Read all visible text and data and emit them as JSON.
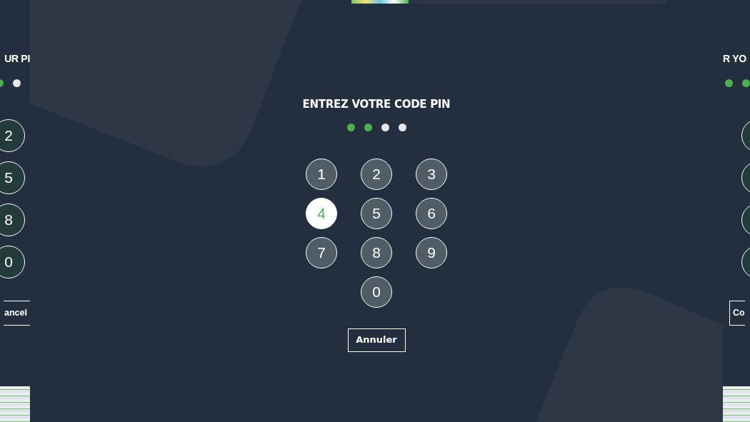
{
  "left_panel": {
    "title": "UR PI",
    "dots": [
      {
        "filled": true
      },
      {
        "filled": false
      }
    ],
    "keys": [
      {
        "label": "2",
        "selected": false
      },
      {
        "label": "5",
        "selected": false
      },
      {
        "label": "8",
        "selected": false
      },
      {
        "label": "0",
        "selected": false
      }
    ],
    "cancel_button": "ancel"
  },
  "main_panel": {
    "title": "ENTREZ VOTRE CODE PIN",
    "dots": [
      {
        "filled": true
      },
      {
        "filled": true
      },
      {
        "filled": false
      },
      {
        "filled": false
      }
    ],
    "keys": [
      {
        "label": "1",
        "selected": false
      },
      {
        "label": "2",
        "selected": false
      },
      {
        "label": "3",
        "selected": false
      },
      {
        "label": "4",
        "selected": true
      },
      {
        "label": "5",
        "selected": false
      },
      {
        "label": "6",
        "selected": false
      },
      {
        "label": "7",
        "selected": false
      },
      {
        "label": "8",
        "selected": false
      },
      {
        "label": "9",
        "selected": false
      },
      {
        "label": "0",
        "selected": false
      }
    ],
    "cancel_button": "Annuler"
  },
  "right_panel": {
    "title": "R YO",
    "dots": [
      {
        "filled": true
      },
      {
        "filled": true
      }
    ],
    "keys": [
      {
        "selected": false
      },
      {
        "selected": false
      },
      {
        "selected": false
      },
      {
        "selected": false
      }
    ],
    "cancel_button": "Co"
  }
}
